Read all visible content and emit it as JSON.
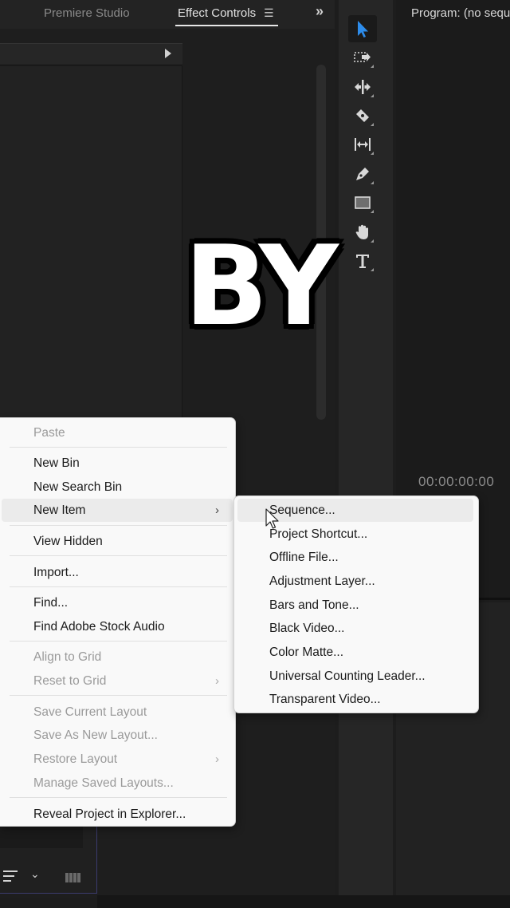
{
  "tabs": {
    "studio": "Premiere Studio",
    "effect_controls": "Effect Controls",
    "menu_glyph": "☰",
    "overflow_glyph": "»"
  },
  "program": {
    "title": "Program: (no sequ",
    "timecode": "00:00:00:00"
  },
  "caption": "BY",
  "tools": [
    "selection-tool",
    "track-select-forward-tool",
    "ripple-edit-tool",
    "razor-tool",
    "slip-tool",
    "pen-tool",
    "rectangle-tool",
    "hand-tool",
    "type-tool"
  ],
  "accent": "#2d8ceb",
  "context_menu": {
    "items": [
      {
        "label": "Paste",
        "disabled": true
      },
      {
        "label": "New Bin",
        "disabled": false
      },
      {
        "label": "New Search Bin",
        "disabled": false
      },
      {
        "label": "New Item",
        "disabled": false,
        "submenu": true,
        "highlighted": true
      },
      {
        "label": "View Hidden",
        "disabled": false
      },
      {
        "label": "Import...",
        "disabled": false
      },
      {
        "label": "Find...",
        "disabled": false
      },
      {
        "label": "Find Adobe Stock Audio",
        "disabled": false
      },
      {
        "label": "Align to Grid",
        "disabled": true
      },
      {
        "label": "Reset to Grid",
        "disabled": true,
        "submenu": true
      },
      {
        "label": "Save Current Layout",
        "disabled": true
      },
      {
        "label": "Save As New Layout...",
        "disabled": true
      },
      {
        "label": "Restore Layout",
        "disabled": true,
        "submenu": true
      },
      {
        "label": "Manage Saved Layouts...",
        "disabled": true
      },
      {
        "label": "Reveal Project in Explorer...",
        "disabled": false
      }
    ],
    "submenu_arrow": "›"
  },
  "submenu": {
    "items": [
      "Sequence...",
      "Project Shortcut...",
      "Offline File...",
      "Adjustment Layer...",
      "Bars and Tone...",
      "Black Video...",
      "Color Matte...",
      "Universal Counting Leader...",
      "Transparent Video..."
    ]
  },
  "project_panel": {
    "dropdown_glyph": "⌄"
  }
}
